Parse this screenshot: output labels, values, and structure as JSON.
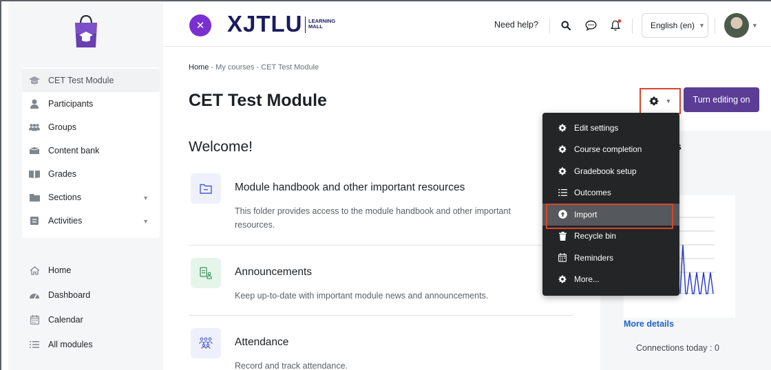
{
  "topbar": {
    "brand": "XJTLU",
    "brand_sub_1": "LEARNING",
    "brand_sub_2": "MALL",
    "need_help": "Need help?",
    "language": "English (en)"
  },
  "sidebar": {
    "course_items": [
      {
        "label": "CET Test Module",
        "icon": "graduation-cap-icon"
      },
      {
        "label": "Participants",
        "icon": "user-icon"
      },
      {
        "label": "Groups",
        "icon": "users-icon"
      },
      {
        "label": "Content bank",
        "icon": "box-icon"
      },
      {
        "label": "Grades",
        "icon": "book-icon"
      },
      {
        "label": "Sections",
        "icon": "folder-icon"
      },
      {
        "label": "Activities",
        "icon": "activity-icon"
      }
    ],
    "site_items": [
      {
        "label": "Home",
        "icon": "home-icon"
      },
      {
        "label": "Dashboard",
        "icon": "dashboard-icon"
      },
      {
        "label": "Calendar",
        "icon": "calendar-icon"
      },
      {
        "label": "All modules",
        "icon": "list-icon"
      }
    ]
  },
  "breadcrumb": {
    "home": "Home",
    "sep": "-",
    "my_courses": "My courses",
    "current": "CET Test Module"
  },
  "page_title": "CET Test Module",
  "edit_button": "Turn editing on",
  "welcome": "Welcome!",
  "activities": [
    {
      "title": "Module handbook and other important resources",
      "desc": "This folder provides access to the module handbook and other important resources.",
      "icon": "folder-icon"
    },
    {
      "title": "Announcements",
      "desc": "Keep up-to-date with important module news and announcements.",
      "icon": "forum-icon"
    },
    {
      "title": "Attendance",
      "desc": "Record and track attendance.",
      "icon": "attendance-icon"
    }
  ],
  "right_block": {
    "title": "ities",
    "more_details": "More details",
    "connections": "Connections today : 0"
  },
  "dropdown": {
    "items": [
      {
        "label": "Edit settings",
        "icon": "gear-icon"
      },
      {
        "label": "Course completion",
        "icon": "gear-icon"
      },
      {
        "label": "Gradebook setup",
        "icon": "gear-icon"
      },
      {
        "label": "Outcomes",
        "icon": "list-check-icon"
      },
      {
        "label": "Import",
        "icon": "upload-icon"
      },
      {
        "label": "Recycle bin",
        "icon": "trash-icon"
      },
      {
        "label": "Reminders",
        "icon": "calendar-icon"
      },
      {
        "label": "More...",
        "icon": "gear-icon"
      }
    ],
    "highlighted": "Import"
  },
  "colors": {
    "accent": "#5b3d96",
    "close_button": "#7a2fd0",
    "highlight_border": "#d9452b",
    "link": "#1e62c7",
    "dropdown_bg": "#232527"
  }
}
